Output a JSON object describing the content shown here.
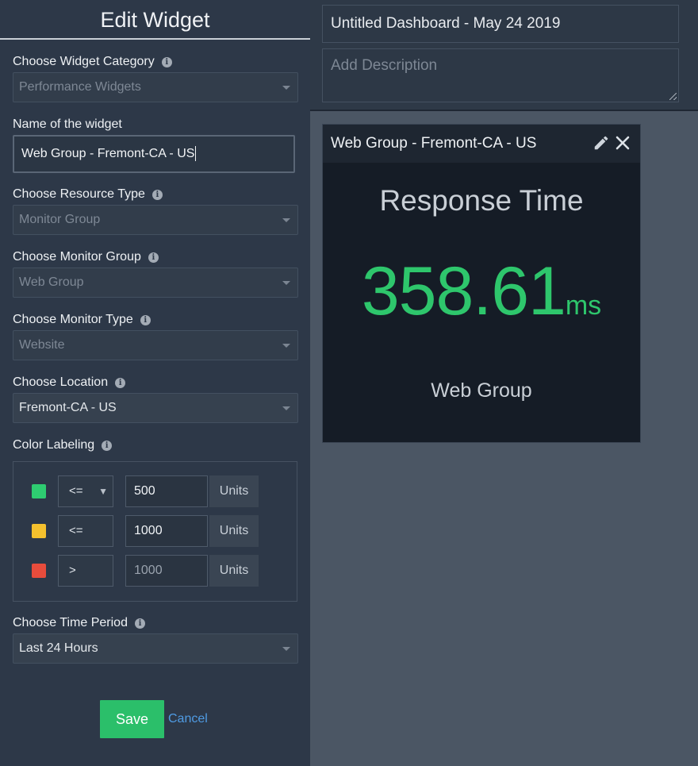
{
  "editor": {
    "title": "Edit Widget",
    "category": {
      "label": "Choose Widget Category",
      "value": "Performance Widgets"
    },
    "name": {
      "label": "Name of the widget",
      "value": "Web Group - Fremont-CA - US"
    },
    "resource_type": {
      "label": "Choose Resource Type",
      "value": "Monitor Group"
    },
    "monitor_group": {
      "label": "Choose Monitor Group",
      "value": "Web Group"
    },
    "monitor_type": {
      "label": "Choose Monitor Type",
      "value": "Website"
    },
    "location": {
      "label": "Choose Location",
      "value": "Fremont-CA - US"
    },
    "color_labeling": {
      "label": "Color Labeling",
      "rows": [
        {
          "color": "#2ecc71",
          "operator": "<=",
          "value": "500",
          "units": "Units"
        },
        {
          "color": "#f5c12e",
          "operator": "<=",
          "value": "1000",
          "units": "Units"
        },
        {
          "color": "#e74c3c",
          "operator": ">",
          "value": "1000",
          "units": "Units"
        }
      ]
    },
    "time_period": {
      "label": "Choose Time Period",
      "value": "Last 24 Hours"
    },
    "save_label": "Save",
    "cancel_label": "Cancel"
  },
  "dashboard": {
    "title": "Untitled Dashboard - May 24 2019",
    "description_placeholder": "Add Description"
  },
  "widget": {
    "title": "Web Group - Fremont-CA - US",
    "metric_name": "Response Time",
    "value": "358.61",
    "unit": "ms",
    "group": "Web Group",
    "value_color": "#2ec66c"
  }
}
